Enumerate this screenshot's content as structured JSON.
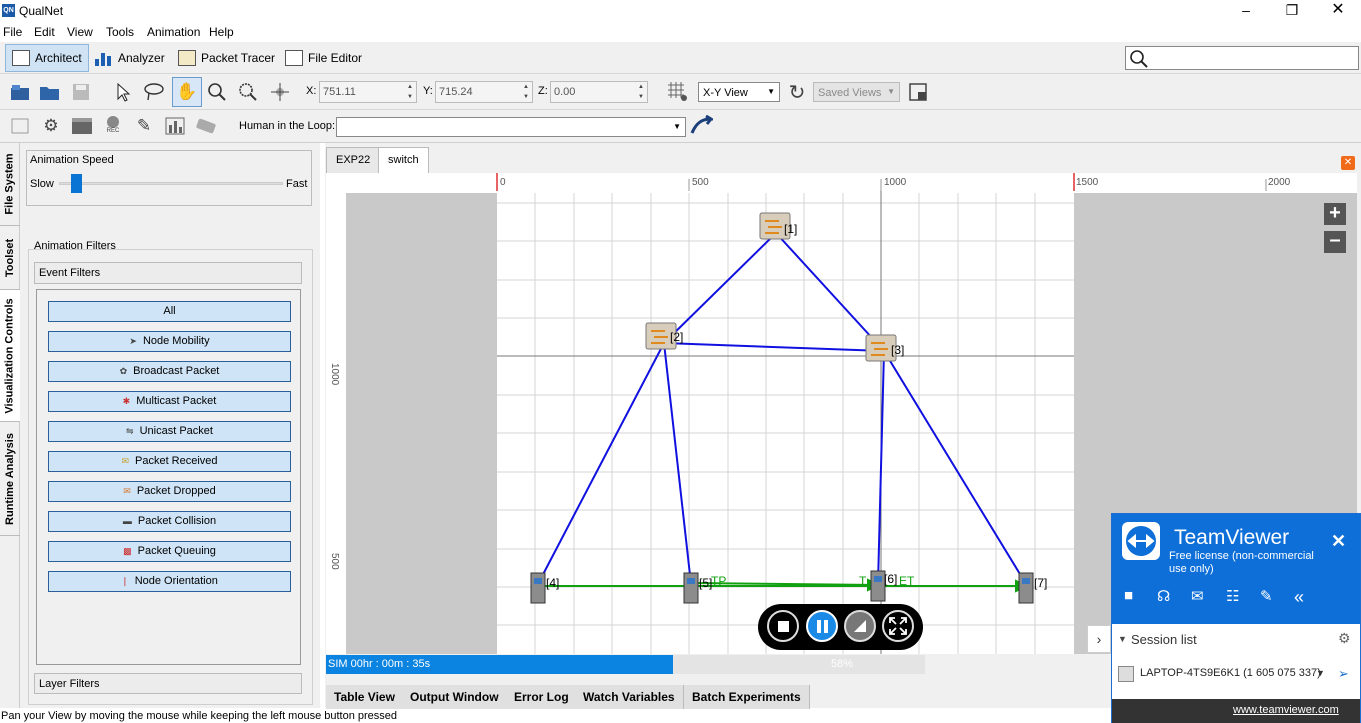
{
  "window": {
    "title": "QualNet",
    "icon_label": "QN"
  },
  "menu": [
    "File",
    "Edit",
    "View",
    "Tools",
    "Animation",
    "Help"
  ],
  "modes": [
    {
      "label": "Architect",
      "active": true
    },
    {
      "label": "Analyzer"
    },
    {
      "label": "Packet Tracer"
    },
    {
      "label": "File Editor"
    }
  ],
  "coords": {
    "x_label": "X:",
    "x_value": "751.11",
    "y_label": "Y:",
    "y_value": "715.24",
    "z_label": "Z:",
    "z_value": "0.00"
  },
  "view_select": "X-Y View",
  "saved_views": "Saved Views",
  "hitl_label": "Human in the Loop:",
  "side_tabs": [
    "File System",
    "Toolset",
    "Visualization Controls",
    "Runtime Analysis"
  ],
  "speed": {
    "title": "Animation Speed",
    "slow": "Slow",
    "fast": "Fast",
    "level": 0.07
  },
  "filters": {
    "group": "Animation Filters",
    "event": "Event Filters",
    "layer": "Layer Filters",
    "buttons": [
      "All",
      "Node Mobility",
      "Broadcast Packet",
      "Multicast Packet",
      "Unicast Packet",
      "Packet Received",
      "Packet Dropped",
      "Packet Collision",
      "Packet Queuing",
      "Node Orientation"
    ]
  },
  "doc_tabs": [
    "EXP22",
    "switch"
  ],
  "ruler": {
    "x_ticks": [
      "0",
      "500",
      "1000",
      "1500",
      "2000"
    ],
    "y_ticks": [
      "1000",
      "500"
    ]
  },
  "nodes": [
    {
      "id": "[1]",
      "type": "switch"
    },
    {
      "id": "[2]",
      "type": "switch"
    },
    {
      "id": "[3]",
      "type": "switch"
    },
    {
      "id": "[4]",
      "type": "host"
    },
    {
      "id": "[5]",
      "type": "host"
    },
    {
      "id": "[6]",
      "type": "host"
    },
    {
      "id": "[7]",
      "type": "host"
    }
  ],
  "link_labels": {
    "a": "TP",
    "b": "T",
    "c": "ET"
  },
  "sim": {
    "time": "SIM 00hr : 00m : 35s",
    "progress": "58%",
    "fraction": 0.58
  },
  "bottom_tabs": [
    "Table View",
    "Output Window",
    "Error Log",
    "Watch Variables",
    "Batch Experiments"
  ],
  "status": "Pan your View by moving the mouse while keeping the left mouse button pressed",
  "teamviewer": {
    "brand": "TeamViewer",
    "license": "Free license (non-commercial use only)",
    "session_title": "Session list",
    "device": "LAPTOP-4TS9E6K1 (1 605 075 337)",
    "link": "www.teamviewer.com"
  },
  "colors": {
    "accent": "#0e6fd8",
    "link": "#1010e0",
    "traffic": "#10a010",
    "progress": "#0a84e0"
  }
}
